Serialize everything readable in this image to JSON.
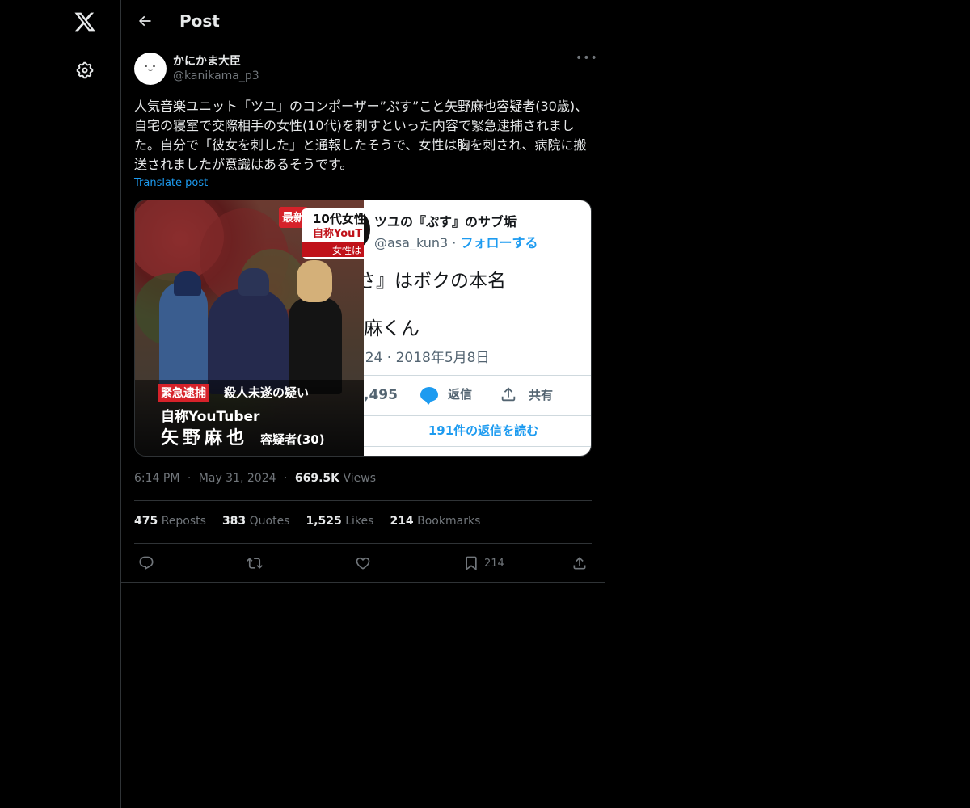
{
  "nav": {
    "logo_icon": "x-logo-icon",
    "settings_icon": "gear-icon"
  },
  "header": {
    "title": "Post"
  },
  "author": {
    "name": "かにかま大臣",
    "handle": "@kanikama_p3"
  },
  "post": {
    "text": "人気音楽ユニット「ツユ」のコンポーザー”ぷす”こと矢野麻也容疑者(30歳)、自宅の寝室で交際相手の女性(10代)を刺すといった内容で緊急逮捕されました。自分で「彼女を刺した」と通報したそうで、女性は胸を刺され、病院に搬送されましたが意識はあるそうです。",
    "translate_label": "Translate post"
  },
  "media_left": {
    "badge": "最新",
    "headline_1": "10代女性",
    "headline_2": "自称YouT",
    "headline_3": "女性は",
    "caption_tag": "緊急逮捕",
    "caption_1": "殺人未遂の疑い",
    "caption_2": "自称YouTuber",
    "caption_3": "矢野麻也",
    "caption_4": "容疑者(30)"
  },
  "media_right": {
    "name": "ツユの『ぷす』のサブ垢",
    "handle": "@asa_kun3",
    "separator": " · ",
    "follow": "フォローする",
    "line1": "さ』はボクの本名",
    "line2": "麻くん",
    "date": ":24 · 2018年5月8日",
    "stat_count": ",495",
    "reply_label": "返信",
    "share_label": "共有",
    "read_replies": "191件の返信を読む"
  },
  "meta": {
    "time": "6:14 PM",
    "date": "May 31, 2024",
    "dot": "·",
    "views_count": "669.5K",
    "views_label": "Views"
  },
  "stats": {
    "reposts_count": "475",
    "reposts_label": "Reposts",
    "quotes_count": "383",
    "quotes_label": "Quotes",
    "likes_count": "1,525",
    "likes_label": "Likes",
    "bookmarks_count": "214",
    "bookmarks_label": "Bookmarks"
  },
  "actions": {
    "bookmark_count": "214"
  }
}
